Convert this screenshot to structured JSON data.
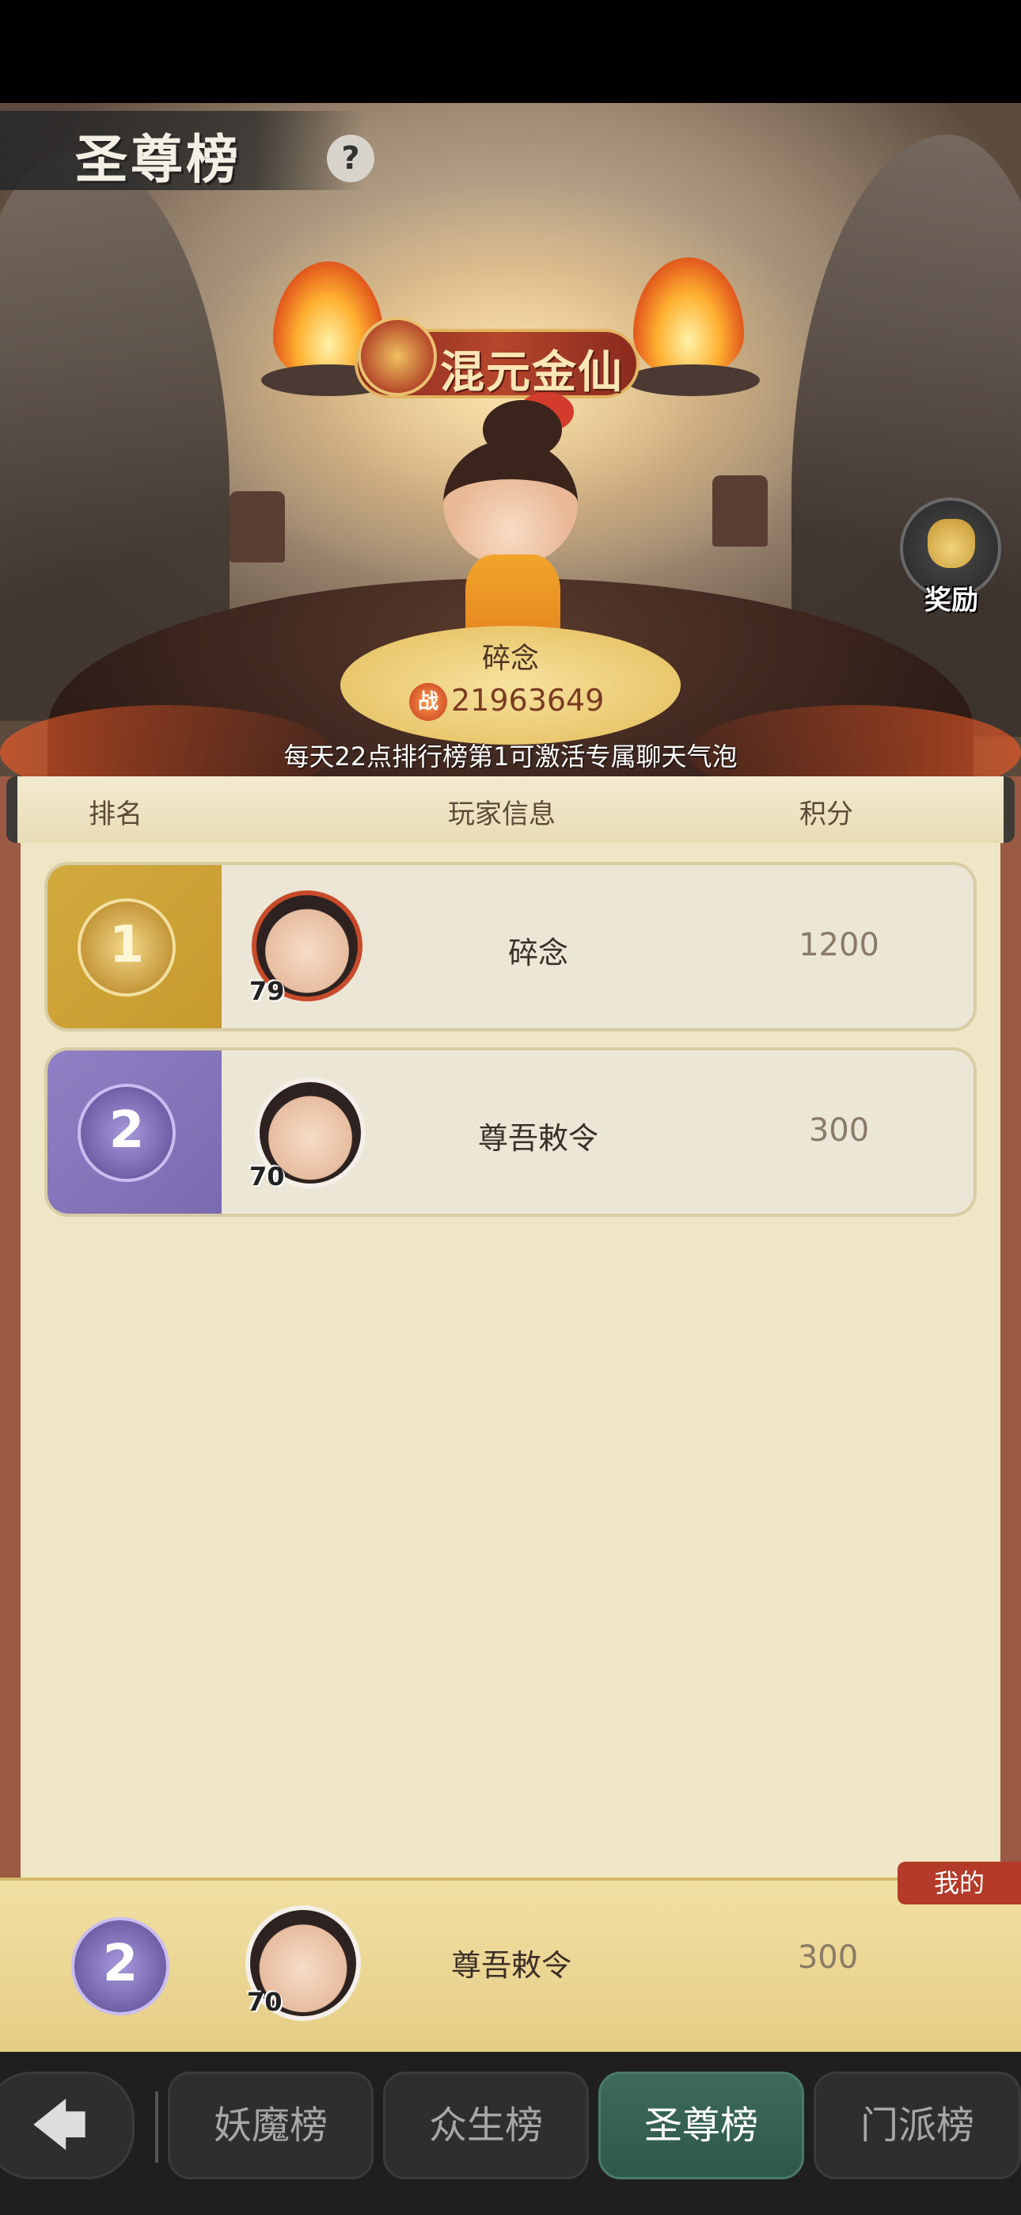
{
  "page": {
    "title": "圣尊榜",
    "help_icon": "?",
    "realm_title": "混元金仙",
    "reward_label": "奖励"
  },
  "top_player": {
    "name": "碎念",
    "power_icon": "战",
    "power": "21963649"
  },
  "hint": "每天22点排行榜第1可激活专属聊天气泡",
  "table": {
    "headers": [
      "排名",
      "玩家信息",
      "积分"
    ],
    "rows": [
      {
        "rank": "1",
        "level": "79",
        "name": "碎念",
        "score": "1200"
      },
      {
        "rank": "2",
        "level": "70",
        "name": "尊吾敕令",
        "score": "300"
      }
    ]
  },
  "mine": {
    "tag": "我的",
    "rank": "2",
    "level": "70",
    "name": "尊吾敕令",
    "score": "300"
  },
  "nav": {
    "back_icon": "🡄",
    "tabs": [
      "妖魔榜",
      "众生榜",
      "圣尊榜",
      "门派榜"
    ],
    "active": "圣尊榜"
  }
}
